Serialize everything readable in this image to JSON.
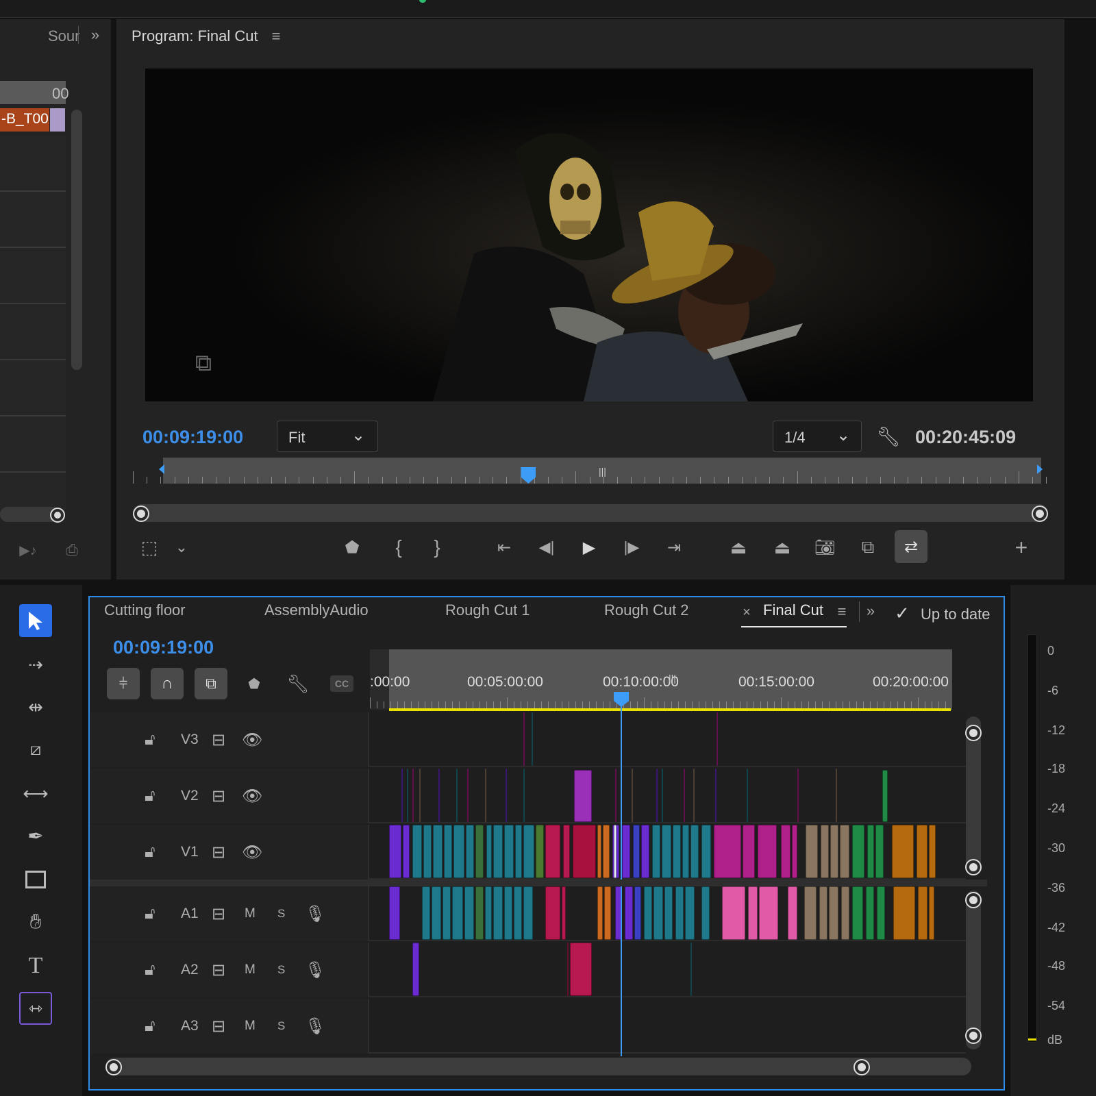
{
  "source_panel": {
    "tab_label": "Sour",
    "ruler_label": "00",
    "clip_label": "-B_T00"
  },
  "program_monitor": {
    "title": "Program: Final Cut",
    "current_timecode": "00:09:19:00",
    "zoom_select": "Fit",
    "resolution_select": "1/4",
    "duration_timecode": "00:20:45:09",
    "playhead_fraction": 0.416
  },
  "timeline": {
    "tabs": [
      "Cutting floor",
      "AssemblyAudio",
      "Rough Cut 1",
      "Rough Cut 2",
      "Final Cut"
    ],
    "active_tab": "Final Cut",
    "status": "Up to date",
    "current_timecode": "00:09:19:00",
    "ruler_labels": [
      ":00:00",
      "00:05:00:00",
      "00:10:00:00",
      "00:15:00:00",
      "00:20:00:00"
    ],
    "video_tracks": [
      "V3",
      "V2",
      "V1"
    ],
    "audio_tracks": [
      "A1",
      "A2",
      "A3"
    ],
    "mute_label": "M",
    "solo_label": "S",
    "cc_label": "CC"
  },
  "audio_meter": {
    "scale": [
      "0",
      "-6",
      "-12",
      "-18",
      "-24",
      "-30",
      "-36",
      "-42",
      "-48",
      "-54",
      "dB"
    ]
  },
  "colors": {
    "accent_blue": "#2d8ceb",
    "playhead": "#3d9cf5",
    "work_area": "#e8e000",
    "clip_purple": "#6a2bd0",
    "clip_teal": "#1e7a8a",
    "clip_crimson": "#b81850",
    "clip_magenta": "#b0208a",
    "clip_tan": "#8a7560",
    "clip_green": "#1f8a45",
    "clip_orange": "#b56a10"
  }
}
